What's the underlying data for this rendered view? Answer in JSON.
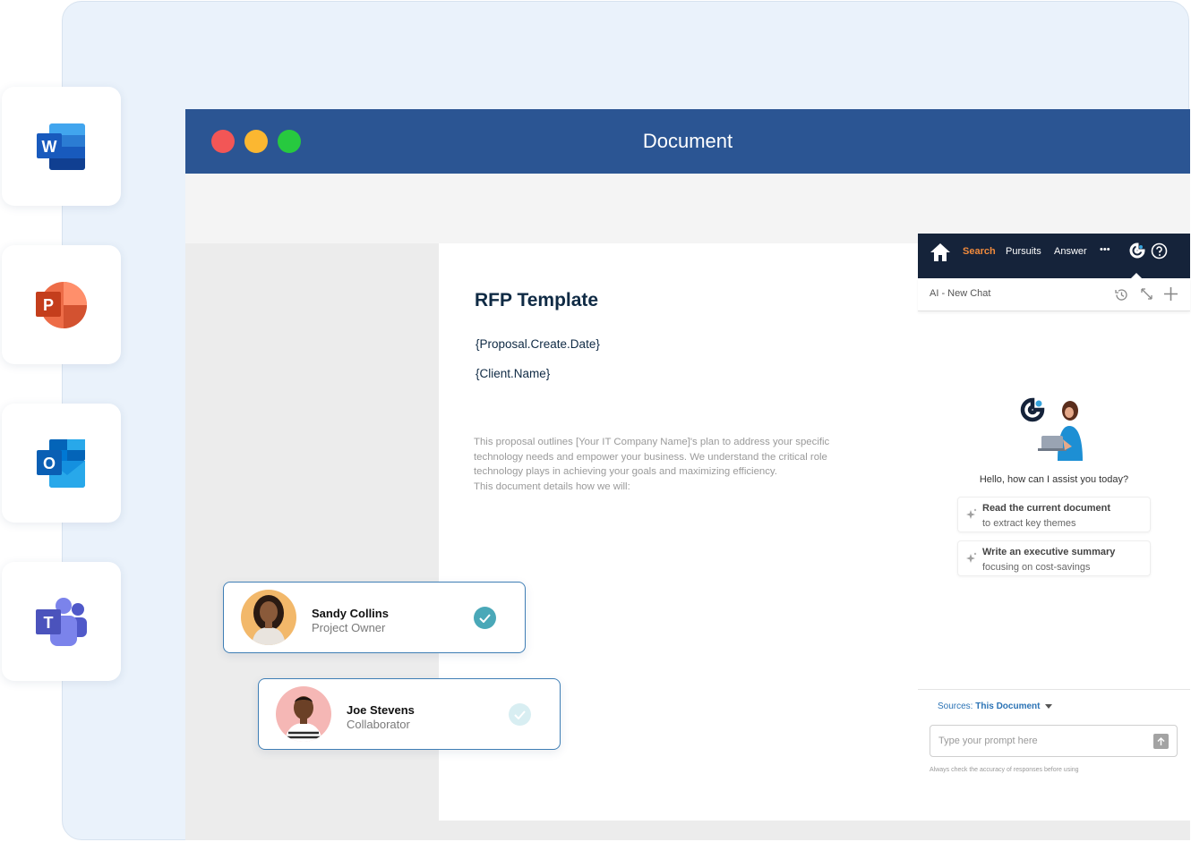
{
  "apps": [
    {
      "name": "Word",
      "letter": "W"
    },
    {
      "name": "PowerPoint",
      "letter": "P"
    },
    {
      "name": "Outlook",
      "letter": "O"
    },
    {
      "name": "Teams",
      "letter": "T"
    }
  ],
  "window": {
    "title": "Document",
    "colors": {
      "close": "#f25656",
      "minimize": "#fbb731",
      "maximize": "#27c93f",
      "titlebar": "#2b5593"
    }
  },
  "document": {
    "title": "RFP Template",
    "fields": [
      "{Proposal.Create.Date}",
      "{Client.Name}"
    ],
    "body": [
      "This proposal outlines [Your IT Company Name]'s plan to address your specific",
      "technology needs and empower your business. We understand the critical role",
      "technology plays in achieving your goals and maximizing efficiency.",
      "This document details how we will:"
    ]
  },
  "collaborators": [
    {
      "name": "Sandy Collins",
      "role": "Project Owner",
      "status": "confirmed"
    },
    {
      "name": "Joe Stevens",
      "role": "Collaborator",
      "status": "pending"
    }
  ],
  "assistant": {
    "nav": {
      "search": "Search",
      "pursuits": "Pursuits",
      "answer": "Answer",
      "more": "•••"
    },
    "chat_title": "AI - New Chat",
    "greeting": "Hello, how can I assist you today?",
    "suggestions": [
      {
        "title": "Read the current document",
        "subtitle": "to extract key themes"
      },
      {
        "title": "Write an executive summary",
        "subtitle": "focusing on cost-savings"
      }
    ],
    "sources_label": "Sources:",
    "sources_value": "This Document",
    "prompt_placeholder": "Type your prompt here",
    "disclaimer": "Always check the accuracy of responses before using",
    "accent": "#f08a3c"
  }
}
